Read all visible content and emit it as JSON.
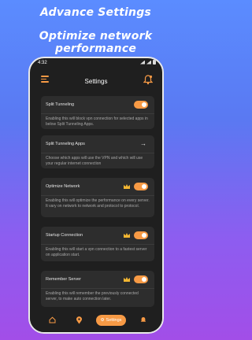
{
  "promo": {
    "line1": "Advance Settings",
    "line2": "Optimize network performance"
  },
  "statusbar": {
    "time": "4:32"
  },
  "appbar": {
    "title": "Settings"
  },
  "settings": [
    {
      "label": "Split Tunneling",
      "desc": "Enabling this will block vpn connection for selected apps in below Split Tunneling Apps.",
      "toggle": true,
      "premium": false
    },
    {
      "label": "Split Tunneling Apps",
      "desc": "Choose which apps will use the VPN and which will use your regular internet connection",
      "arrow": true
    },
    {
      "label": "Optimize Network",
      "desc": "Enabling this will optimize the performance on every server. It vary on network to network and protocol to protocol.",
      "toggle": true,
      "premium": true
    },
    {
      "label": "Startup Connection",
      "desc": "Enabling this will start a vpn connection to a fastest server on application start.",
      "toggle": true,
      "premium": true
    },
    {
      "label": "Remember Server",
      "desc": "Enabling this will remember the previously connected server, to make auto connection later.",
      "toggle": true,
      "premium": true
    }
  ],
  "bottomnav": {
    "active_label": "Settings"
  },
  "colors": {
    "accent": "#f79a45",
    "card": "#2d2d2d",
    "bg": "#1f1f1f"
  }
}
